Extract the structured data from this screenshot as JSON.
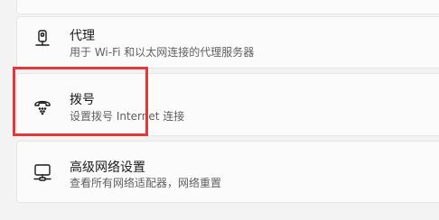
{
  "settings": {
    "items": [
      {
        "title": "代理",
        "description": "用于 Wi-Fi 和以太网连接的代理服务器",
        "icon": "proxy-icon"
      },
      {
        "title": "拨号",
        "description": "设置拨号 Internet 连接",
        "icon": "dial-up-icon"
      },
      {
        "title": "高级网络设置",
        "description": "查看所有网络适配器，网络重置",
        "icon": "advanced-network-icon"
      }
    ]
  },
  "colors": {
    "highlight": "#e0383b",
    "card_background": "#fbfbfb",
    "page_background": "#f3f3f3"
  }
}
